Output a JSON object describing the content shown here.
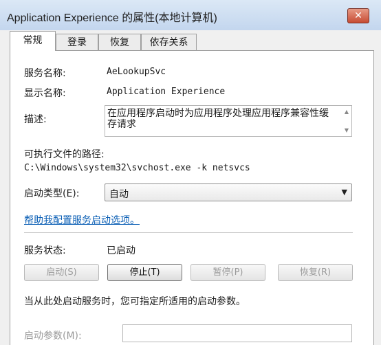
{
  "window": {
    "title": "Application Experience 的属性(本地计算机)",
    "close_glyph": "✕"
  },
  "tabs": [
    {
      "label": "常规",
      "active": true
    },
    {
      "label": "登录"
    },
    {
      "label": "恢复"
    },
    {
      "label": "依存关系"
    }
  ],
  "general": {
    "service_name_label": "服务名称:",
    "service_name": "AeLookupSvc",
    "display_name_label": "显示名称:",
    "display_name": "Application Experience",
    "description_label": "描述:",
    "description": "在应用程序启动时为应用程序处理应用程序兼容性缓存请求",
    "path_label": "可执行文件的路径:",
    "path": "C:\\Windows\\system32\\svchost.exe -k netsvcs",
    "startup_type_label": "启动类型(E):",
    "startup_type_value": "自动",
    "help_link": "帮助我配置服务启动选项。",
    "status_label": "服务状态:",
    "status_value": "已启动",
    "buttons": {
      "start": "启动(S)",
      "stop": "停止(T)",
      "pause": "暂停(P)",
      "resume": "恢复(R)"
    },
    "hint": "当从此处启动服务时，您可指定所适用的启动参数。",
    "params_label": "启动参数(M):",
    "params_value": ""
  },
  "icons": {
    "scroll_up": "▲",
    "scroll_down": "▼",
    "dropdown": "▼"
  }
}
